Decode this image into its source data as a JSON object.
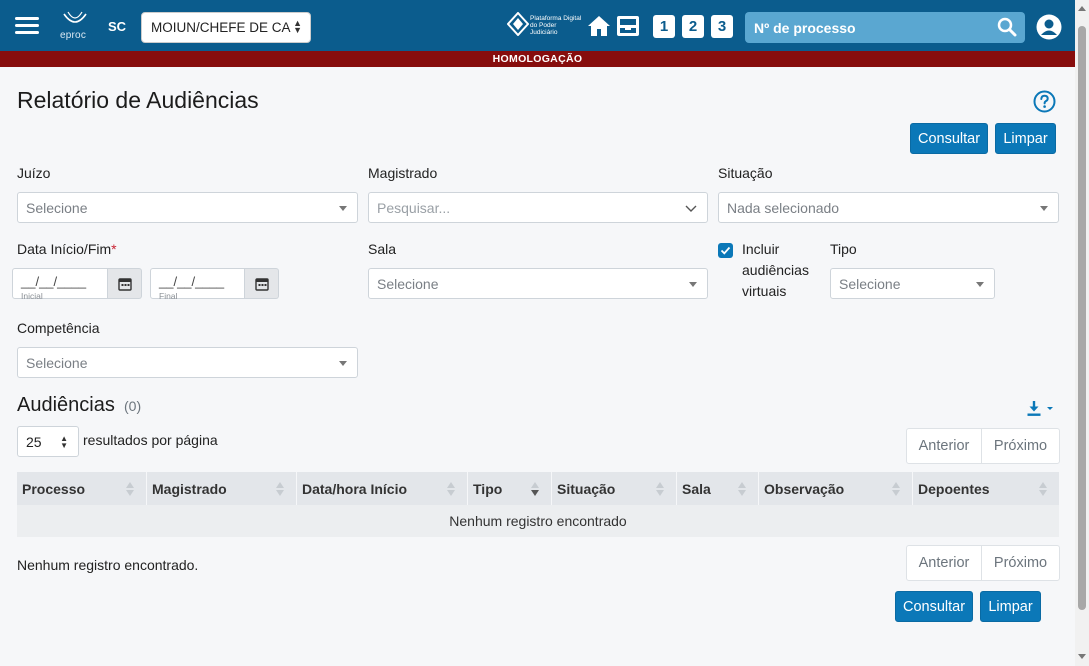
{
  "header": {
    "app_logo_text": "eproc",
    "state": "SC",
    "profile_selected": "MOIUN/CHEFE DE CA",
    "pdpj_logo_text": "Plataforma Digital do Poder Judiciário",
    "quick_buttons": [
      "1",
      "2",
      "3"
    ],
    "search_placeholder": "Nº de processo",
    "environment_banner": "HOMOLOGAÇÃO"
  },
  "page": {
    "title": "Relatório de Audiências"
  },
  "actions": {
    "consultar_label": "Consultar",
    "limpar_label": "Limpar"
  },
  "filters": {
    "juizo": {
      "label": "Juízo",
      "value": "Selecione"
    },
    "magistrado": {
      "label": "Magistrado",
      "placeholder": "Pesquisar..."
    },
    "situacao": {
      "label": "Situação",
      "value": "Nada selecionado"
    },
    "data": {
      "label": "Data Início/Fim",
      "required_mark": "*",
      "start_mask": "__/__/____",
      "start_sub": "Inicial",
      "end_mask": "__/__/____",
      "end_sub": "Final"
    },
    "sala": {
      "label": "Sala",
      "value": "Selecione"
    },
    "virtual": {
      "label": "Incluir audiências virtuais",
      "checked": true
    },
    "tipo": {
      "label": "Tipo",
      "value": "Selecione"
    },
    "competencia": {
      "label": "Competência",
      "value": "Selecione"
    }
  },
  "results": {
    "title": "Audiências",
    "count": "(0)",
    "per_page": "25",
    "per_page_label": "resultados por página",
    "prev_label": "Anterior",
    "next_label": "Próximo",
    "columns": [
      "Processo",
      "Magistrado",
      "Data/hora Início",
      "Tipo",
      "Situação",
      "Sala",
      "Observação",
      "Depoentes"
    ],
    "empty_row": "Nenhum registro encontrado",
    "footer_message": "Nenhum registro encontrado."
  },
  "colors": {
    "header_bg": "#0b5c8d",
    "banner_bg": "#870d0d",
    "primary": "#0b78b8",
    "content_bg": "#f6f7f9"
  }
}
